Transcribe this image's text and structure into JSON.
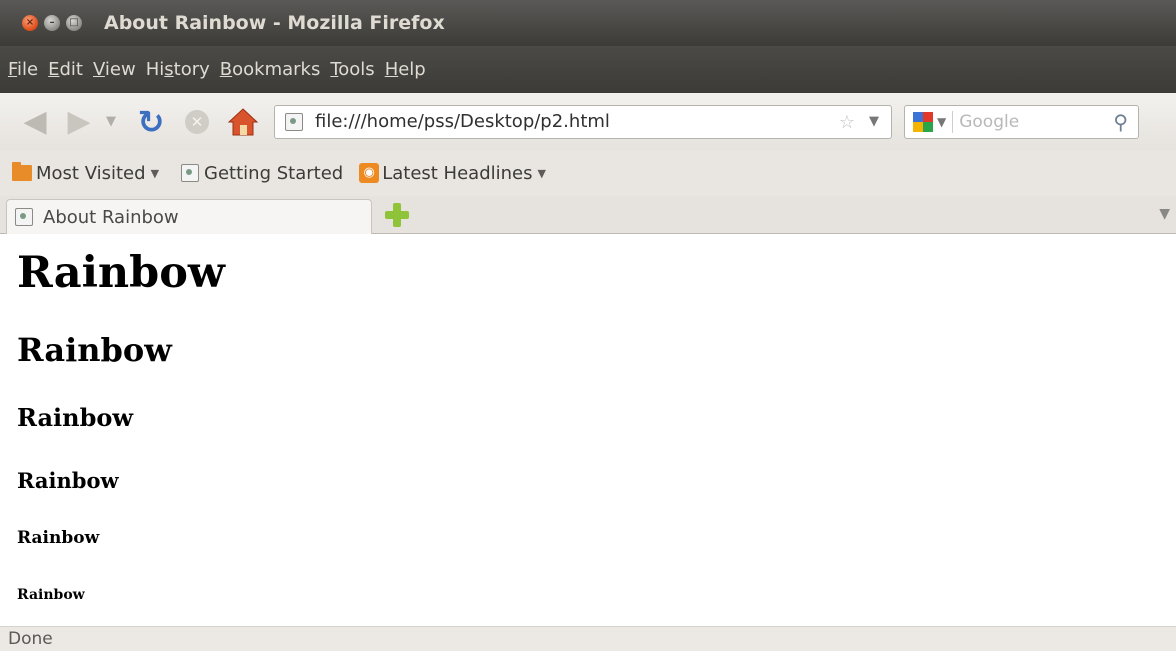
{
  "window": {
    "title": "About Rainbow - Mozilla Firefox"
  },
  "menu": {
    "items": [
      {
        "mnemonic": "F",
        "rest": "ile"
      },
      {
        "mnemonic": "E",
        "rest": "dit"
      },
      {
        "mnemonic": "V",
        "rest": "iew"
      },
      {
        "pre": "Hi",
        "mnemonic": "s",
        "rest": "tory"
      },
      {
        "mnemonic": "B",
        "rest": "ookmarks"
      },
      {
        "mnemonic": "T",
        "rest": "ools"
      },
      {
        "mnemonic": "H",
        "rest": "elp"
      }
    ]
  },
  "navigation": {
    "url": "file:///home/pss/Desktop/p2.html",
    "search_placeholder": "Google",
    "icons": [
      "back-icon",
      "forward-icon",
      "history-dropdown-icon",
      "reload-icon",
      "stop-icon",
      "home-icon",
      "bookmark-star-icon",
      "search-engine-icon",
      "search-icon"
    ]
  },
  "bookmarks": {
    "items": [
      {
        "label": "Most Visited",
        "icon": "folder-icon",
        "has_dropdown": true
      },
      {
        "label": "Getting Started",
        "icon": "page-icon",
        "has_dropdown": false
      },
      {
        "label": "Latest Headlines",
        "icon": "rss-icon",
        "has_dropdown": true
      }
    ]
  },
  "tabs": {
    "items": [
      {
        "label": "About Rainbow",
        "active": true
      }
    ]
  },
  "content": {
    "headings": [
      {
        "level": 1,
        "text": "Rainbow"
      },
      {
        "level": 2,
        "text": "Rainbow"
      },
      {
        "level": 3,
        "text": "Rainbow"
      },
      {
        "level": 4,
        "text": "Rainbow"
      },
      {
        "level": 5,
        "text": "Rainbow"
      },
      {
        "level": 6,
        "text": "Rainbow"
      }
    ]
  },
  "status": {
    "text": "Done"
  },
  "colors": {
    "titlebar": "#3c3b37",
    "close_button": "#df4a16",
    "reload": "#3d6fc1",
    "new_tab": "#8fc33a",
    "rss": "#ee8a22",
    "folder": "#e88b29"
  }
}
